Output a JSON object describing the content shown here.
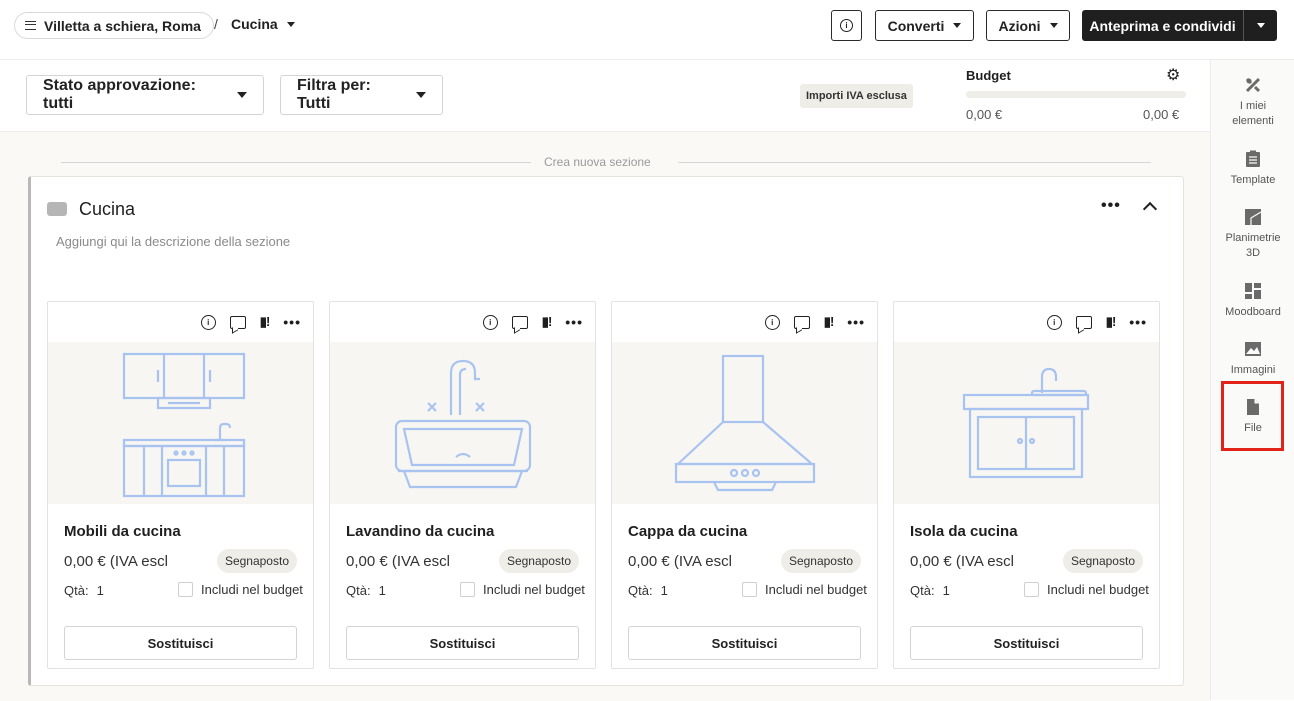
{
  "topbar": {
    "project": "Villetta a schiera, Roma",
    "separator": "/",
    "room": "Cucina",
    "info_icon": "info-icon",
    "converti_label": "Converti",
    "azioni_label": "Azioni",
    "share_label": "Anteprima e condividi"
  },
  "filters": {
    "approval_label": "Stato approvazione: tutti",
    "filter_label": "Filtra per: Tutti",
    "vat_badge": "Importi IVA esclusa"
  },
  "budget": {
    "title": "Budget",
    "spent": "0,00 €",
    "total": "0,00 €",
    "progress": 0
  },
  "canvas": {
    "new_section_label": "Crea nuova sezione"
  },
  "section": {
    "title": "Cucina",
    "description_placeholder": "Aggiungi qui la descrizione della sezione",
    "menu_glyph": "•••",
    "swatch_color": "#b5b5b5"
  },
  "cards": [
    {
      "name": "Mobili da cucina",
      "price": "0,00 € (IVA escl",
      "badge": "Segnaposto",
      "qty_label": "Qtà:",
      "qty": "1",
      "include_label": "Includi nel budget",
      "replace_label": "Sostituisci",
      "image_icon": "kitchen-cabinets-icon"
    },
    {
      "name": "Lavandino da cucina",
      "price": "0,00 € (IVA escl",
      "badge": "Segnaposto",
      "qty_label": "Qtà:",
      "qty": "1",
      "include_label": "Includi nel budget",
      "replace_label": "Sostituisci",
      "image_icon": "kitchen-sink-icon"
    },
    {
      "name": "Cappa da cucina",
      "price": "0,00 € (IVA escl",
      "badge": "Segnaposto",
      "qty_label": "Qtà:",
      "qty": "1",
      "include_label": "Includi nel budget",
      "replace_label": "Sostituisci",
      "image_icon": "range-hood-icon"
    },
    {
      "name": "Isola da cucina",
      "price": "0,00 € (IVA escl",
      "badge": "Segnaposto",
      "qty_label": "Qtà:",
      "qty": "1",
      "include_label": "Includi nel budget",
      "replace_label": "Sostituisci",
      "image_icon": "kitchen-island-icon"
    }
  ],
  "sidebar": {
    "items": [
      {
        "label": "I miei\nelementi",
        "icon": "my-items-icon"
      },
      {
        "label": "Template",
        "icon": "clipboard-icon"
      },
      {
        "label": "Planimetrie\n3D",
        "icon": "floorplan-icon"
      },
      {
        "label": "Moodboard",
        "icon": "moodboard-icon"
      },
      {
        "label": "Immagini",
        "icon": "image-icon"
      },
      {
        "label": "File",
        "icon": "file-icon"
      }
    ],
    "highlighted": "File"
  },
  "colors": {
    "accent_dark": "#1f1f1f",
    "illustration_blue": "#a9c3f0",
    "highlight_red": "#e2231a"
  }
}
